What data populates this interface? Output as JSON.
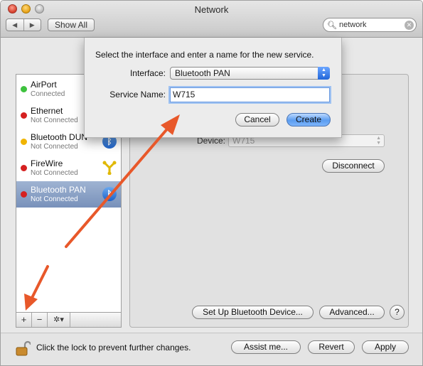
{
  "window": {
    "title": "Network",
    "nav_back": "◀",
    "nav_forward": "▶",
    "show_all_label": "Show All",
    "search_value": "network"
  },
  "sheet": {
    "prompt": "Select the interface and enter a name for the new service.",
    "interface_label": "Interface:",
    "interface_value": "Bluetooth PAN",
    "service_name_label": "Service Name:",
    "service_name_value": "W715",
    "cancel_label": "Cancel",
    "create_label": "Create"
  },
  "sidebar": {
    "services": [
      {
        "name": "AirPort",
        "status": "Connected",
        "dot": "green",
        "icon": "wifi-icon"
      },
      {
        "name": "Ethernet",
        "status": "Not Connected",
        "dot": "red",
        "icon": "ethernet-icon"
      },
      {
        "name": "Bluetooth DUN",
        "status": "Not Connected",
        "dot": "yellow",
        "icon": "bluetooth-icon"
      },
      {
        "name": "FireWire",
        "status": "Not Connected",
        "dot": "red",
        "icon": "firewire-icon"
      },
      {
        "name": "Bluetooth PAN",
        "status": "Not Connected",
        "dot": "red",
        "icon": "bluetooth-icon",
        "selected": true
      }
    ],
    "add_label": "+",
    "remove_label": "−",
    "action_label": "✲▾"
  },
  "detail": {
    "device_label": "Device:",
    "device_value": "W715",
    "disconnect_label": "Disconnect",
    "setup_bluetooth_label": "Set Up Bluetooth Device...",
    "advanced_label": "Advanced...",
    "help_label": "?"
  },
  "footer": {
    "lock_text": "Click the lock to prevent further changes.",
    "assist_label": "Assist me...",
    "revert_label": "Revert",
    "apply_label": "Apply"
  },
  "colors": {
    "accent_blue": "#5a9cf0",
    "selection": "#7891ba",
    "status_green": "#3ec23e",
    "status_red": "#d52020",
    "status_yellow": "#f0b400",
    "annotation_arrow": "#e8582a"
  }
}
